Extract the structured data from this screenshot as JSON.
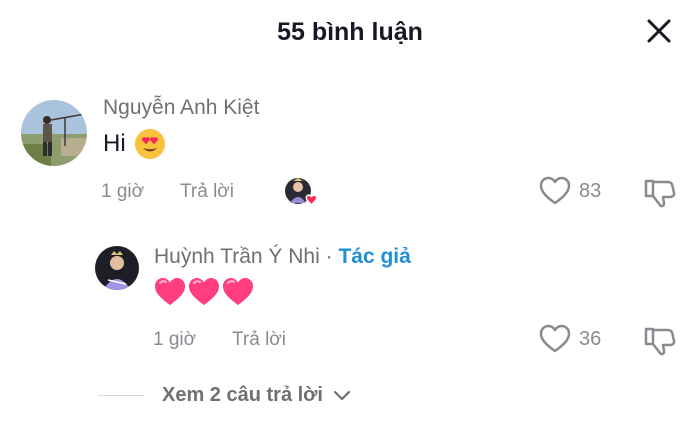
{
  "header": {
    "title": "55 bình luận"
  },
  "comments": [
    {
      "author": "Nguyễn Anh Kiệt",
      "text": "Hi",
      "emoji": "heart-eyes",
      "time": "1 giờ",
      "reply_label": "Trả lời",
      "likes": "83",
      "creator_liked": true
    },
    {
      "author": "Huỳnh Trần Ý Nhi",
      "separator": "·",
      "author_tag": "Tác giả",
      "emoji_text": "hearts",
      "time": "1 giờ",
      "reply_label": "Trả lời",
      "likes": "36"
    }
  ],
  "view_replies": {
    "label": "Xem 2 câu trả lời"
  },
  "colors": {
    "accent_blue": "#1f8fd6",
    "heart_pink": "#fe2c55",
    "muted": "#8a8b91"
  },
  "icons": [
    "close-icon",
    "heart-outline-icon",
    "dislike-icon",
    "chevron-down-icon",
    "heart-eyes-emoji",
    "pink-heart-emoji"
  ]
}
